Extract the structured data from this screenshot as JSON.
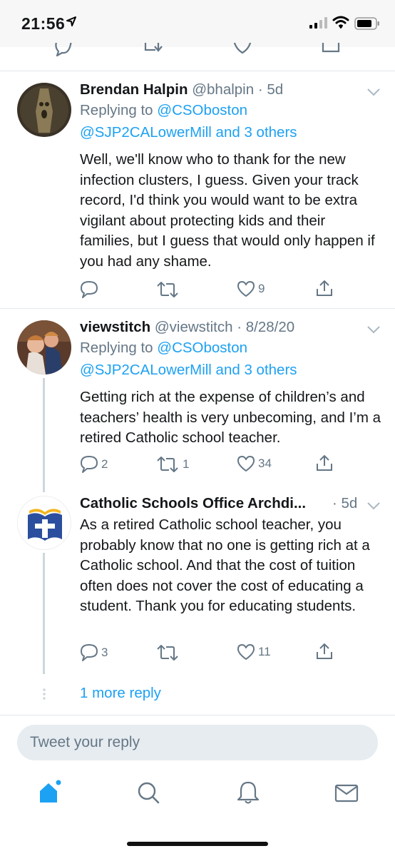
{
  "status_bar": {
    "time": "21:56"
  },
  "tweets": [
    {
      "name": "Brendan Halpin",
      "handle": "@bhalpin",
      "time": "5d",
      "replying_prefix": "Replying to ",
      "replying_to_1": "@CSOboston",
      "replying_to_2": "@SJP2CALowerMill and 3 others",
      "body": "Well, we'll know who to thank for the new infection clusters, I guess. Given your track record, I'd think you would want to be extra vigilant about protecting kids and their families, but I guess that would only happen if you had any shame.",
      "replies": "",
      "retweets": "",
      "likes": "9"
    },
    {
      "name": "viewstitch",
      "handle": "@viewstitch",
      "time": "8/28/20",
      "replying_prefix": "Replying to ",
      "replying_to_1": "@CSOboston",
      "replying_to_2": "@SJP2CALowerMill and 3 others",
      "body": "Getting rich at the expense of children’s and teachers’ health is very unbecoming, and I’m a retired Catholic school teacher.",
      "replies": "2",
      "retweets": "1",
      "likes": "34"
    },
    {
      "name": "Catholic Schools Office Archdi...",
      "time": "5d",
      "body": "As a retired Catholic school teacher, you probably know that no one is getting rich at a Catholic school. And that the cost of tuition often does not cover the cost of educating a student. Thank you for educating students.",
      "replies": "3",
      "retweets": "",
      "likes": "11"
    }
  ],
  "more_reply": "1 more reply",
  "reply_box": {
    "placeholder": "Tweet your reply"
  },
  "colors": {
    "accent": "#1da1f2",
    "muted": "#657786",
    "divider": "#e1e8ed"
  },
  "tab_icons": [
    "home-icon",
    "search-icon",
    "notifications-icon",
    "messages-icon"
  ]
}
